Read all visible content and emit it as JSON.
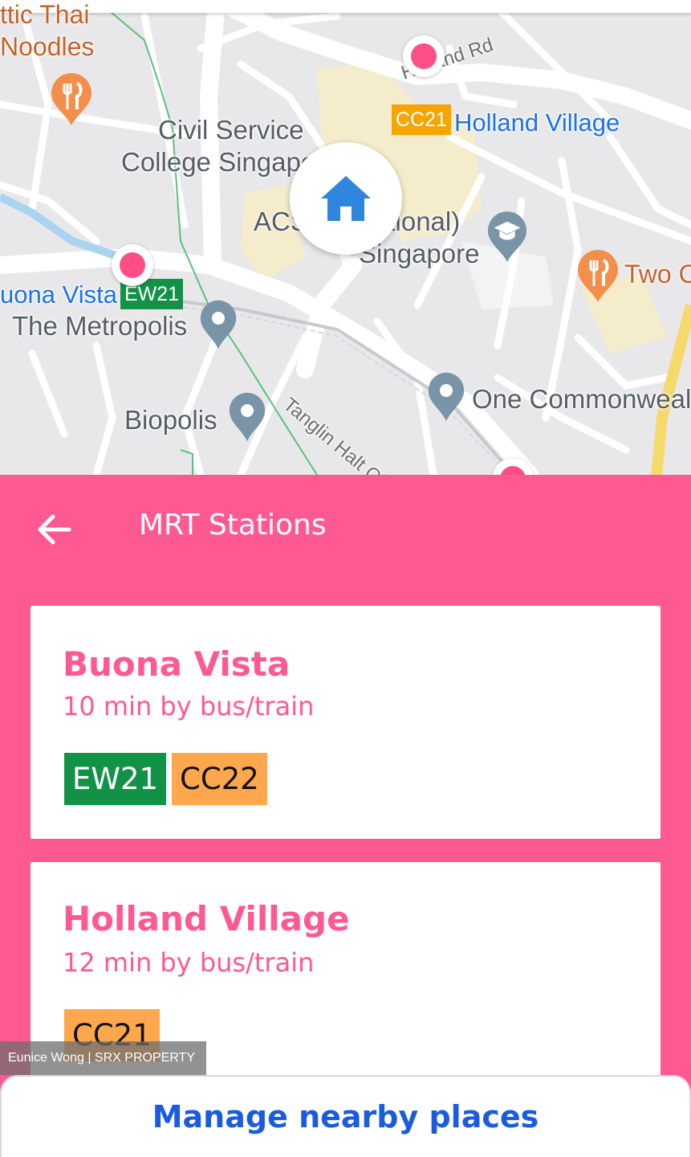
{
  "map": {
    "labels": {
      "thai_noodles_top": "ttic Thai",
      "thai_noodles": "Noodles",
      "holland_rd": "Holland Rd",
      "civil_service_1": "Civil Service",
      "civil_service_2": "College Singapo",
      "acs_1": "ACS",
      "acs_2": "ational)",
      "acs_3": "Singapore",
      "two_c": "Two C",
      "buona_vista": "uona Vista",
      "metropolis": "The Metropolis",
      "tanglin": "Tanglin Halt Cl",
      "one_commonwealth": "One Commonwealt",
      "biopolis": "Biopolis",
      "holland_village": "Holland Village"
    },
    "badges": {
      "cc21": "CC21",
      "ew21": "EW21"
    },
    "icons": [
      "restaurant-icon",
      "home-icon",
      "school-icon",
      "place-icon"
    ],
    "colors": {
      "mrt_green": "#129247",
      "mrt_orange": "#f6a400",
      "pin": "#ff4f86"
    }
  },
  "header": {
    "title": "MRT Stations",
    "back_icon": "arrow-back-icon"
  },
  "stations": [
    {
      "name": "Buona Vista",
      "travel": "10 min by bus/train",
      "lines": [
        {
          "code": "EW21",
          "color": "#129247"
        },
        {
          "code": "CC22",
          "color": "#ffa74d"
        }
      ]
    },
    {
      "name": "Holland Village",
      "travel": "12 min by bus/train",
      "lines": [
        {
          "code": "CC21",
          "color": "#ffa74d"
        }
      ]
    }
  ],
  "watermark": "Eunice Wong | SRX PROPERTY",
  "footer": {
    "manage_label": "Manage nearby places"
  },
  "theme": {
    "accent": "#ff5992",
    "link": "#1a5be0"
  }
}
